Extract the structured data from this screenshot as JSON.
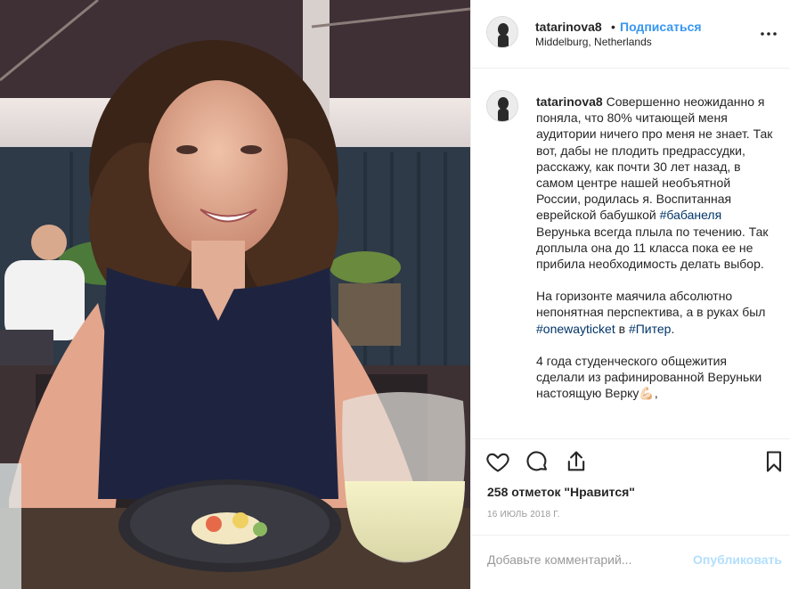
{
  "post": {
    "username": "tatarinova8",
    "separator": "•",
    "follow_label": "Подписаться",
    "location": "Middelburg, Netherlands",
    "more_icon": "more-horizontal-icon"
  },
  "caption": {
    "username": "tatarinova8",
    "p1_text_a": "Совершенно неожиданно я поняла, что 80% читающей меня аудитории ничего про меня не знает. Так вот, дабы не плодить предрассудки, расскажу, как почти 30 лет назад, в самом центре нашей необъятной России, родилась я. Воспитанная еврейской бабушкой ",
    "p1_tag": "#бабанеля",
    "p1_text_b": " Верунька всегда плыла по течению. Так доплыла она до 11 класса пока ее не прибила необходимость делать выбор.",
    "p2_text_a": "На горизонте маячила абсолютно непонятная перспектива, а в руках был ",
    "p2_tag1": "#onewayticket",
    "p2_text_b": " в ",
    "p2_tag2": "#Питер",
    "p2_text_c": ".",
    "p3_text": "4 года студенческого общежития сделали из рафинированной Веруньки настоящую Верку💪🏻,"
  },
  "actions": {
    "like_icon": "heart-icon",
    "comment_icon": "comment-icon",
    "share_icon": "share-icon",
    "save_icon": "bookmark-icon",
    "likes_text": "258 отметок \"Нравится\"",
    "date": "16 ИЮЛЬ 2018 Г."
  },
  "comment": {
    "placeholder": "Добавьте комментарий...",
    "publish_label": "Опубликовать"
  },
  "colors": {
    "link": "#3897f0",
    "hashtag": "#003569",
    "publish_disabled": "#b2dffc"
  }
}
